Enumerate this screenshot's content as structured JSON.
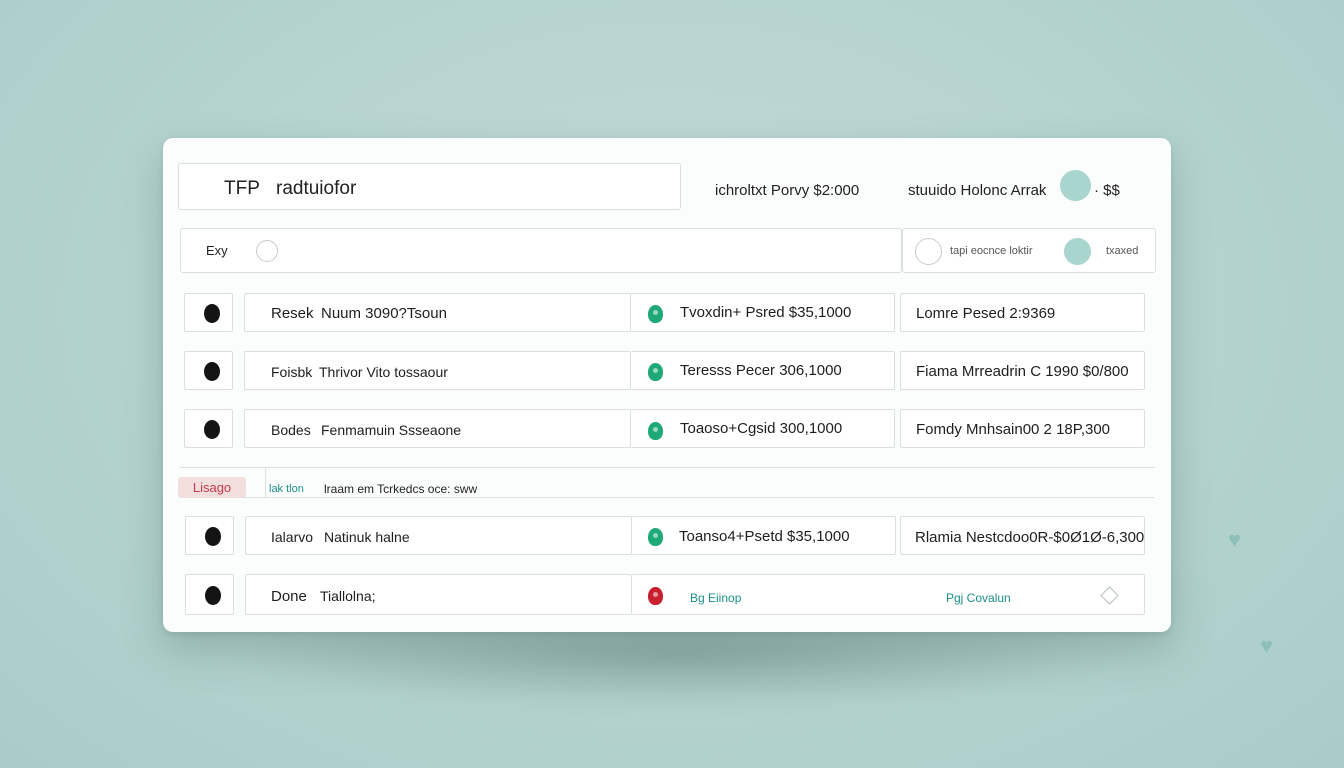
{
  "header": {
    "title_prefix": "TFP",
    "title_value": "radtuiofor",
    "center_text": "ichroltxt Porvy $2:000",
    "right_text": "stuuido Holonc Arrak",
    "right_suffix": "· $$"
  },
  "filter": {
    "label": "Exy",
    "right_text": "tapi eocnce loktir",
    "right_end": "txaxed"
  },
  "rows": [
    {
      "name": "Resek",
      "detail": "Nuum 3090?Tsoun",
      "status": "green",
      "mid": "Tvoxdin+ Psred $35,1000",
      "right": "Lomre Pesed 2:9369"
    },
    {
      "name": "Foisbk",
      "detail": "Thrivor Vito tossaour",
      "status": "green",
      "mid": "Teresss Pecer 306,1000",
      "right": "Fiama Mrreadrin C 1990 $0/800"
    },
    {
      "name": "Bodes",
      "detail": "Fenmamuin Ssseaone",
      "status": "green",
      "mid": "Toaoso+Cgsid 300,1000",
      "right": "Fomdy Mnhsain00 2 18P,300"
    }
  ],
  "section": {
    "tag": "Lisago",
    "left": "lak tlon",
    "text": "lraam em Tcrkedcs oce: sww"
  },
  "rows2": [
    {
      "name": "Ialarvo",
      "detail": "Natinuk halne",
      "status": "green",
      "mid": "Toanso4+Psetd $35,1000",
      "right": "Rlamia Nestcdoo0R-$0Ø1Ø-6,300"
    },
    {
      "name": "Done",
      "detail": "Tiallolna;",
      "status": "red",
      "mid": "Bg Eiinop",
      "right": "Pgj Covalun"
    }
  ],
  "colors": {
    "green": "#1fa878",
    "red": "#c8202e",
    "teal_light": "#a9d5cf",
    "background": "#b3d2ce"
  },
  "icons": [
    "radio-icon",
    "toggle-dot-icon",
    "bullet-icon",
    "status-pin-icon",
    "diamond-icon",
    "heart-icon"
  ]
}
